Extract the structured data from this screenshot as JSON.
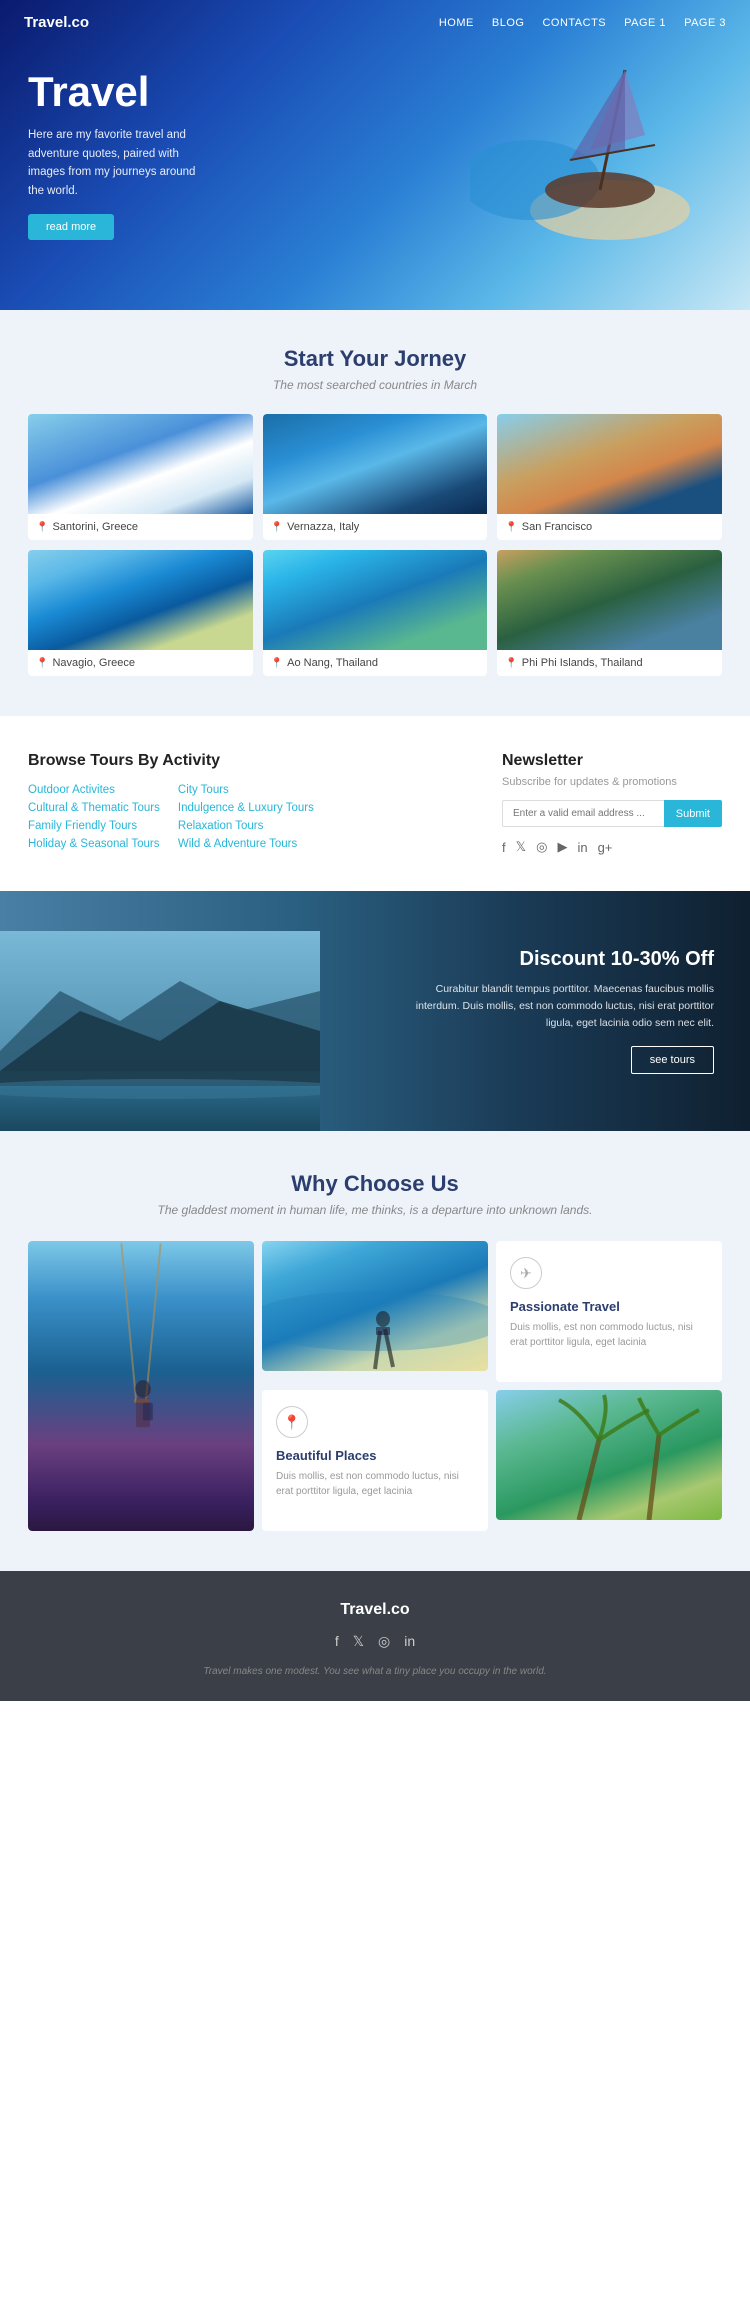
{
  "nav": {
    "logo": "Travel.co",
    "links": [
      "HOME",
      "BLOG",
      "CONTACTS",
      "PAGE 1",
      "PAGE 3"
    ]
  },
  "hero": {
    "title": "Travel",
    "description": "Here are my favorite travel and adventure quotes, paired with images from my journeys around the world.",
    "cta_button": "read more"
  },
  "destinations": {
    "heading": "Start Your Jorney",
    "subtitle": "The most searched countries in March",
    "cards": [
      {
        "name": "Santorini, Greece",
        "color_class": "img-santorini"
      },
      {
        "name": "Vernazza, Italy",
        "color_class": "img-vernazza"
      },
      {
        "name": "San Francisco",
        "color_class": "img-sanfrancisco"
      },
      {
        "name": "Navagio, Greece",
        "color_class": "img-navagio"
      },
      {
        "name": "Ao Nang, Thailand",
        "color_class": "img-aonang"
      },
      {
        "name": "Phi Phi Islands, Thailand",
        "color_class": "img-phiphi"
      }
    ]
  },
  "browse": {
    "heading": "Browse Tours By Activity",
    "col1": [
      "Outdoor Activites",
      "Cultural & Thematic Tours",
      "Family Friendly Tours",
      "Holiday & Seasonal Tours"
    ],
    "col2": [
      "City Tours",
      "Indulgence & Luxury Tours",
      "Relaxation Tours",
      "Wild & Adventure Tours"
    ]
  },
  "newsletter": {
    "heading": "Newsletter",
    "subtitle": "Subscribe for updates & promotions",
    "placeholder": "Enter a valid email address ...",
    "button": "Submit"
  },
  "discount": {
    "heading": "Discount 10-30% Off",
    "body": "Curabitur blandit tempus porttitor. Maecenas faucibus mollis interdum. Duis mollis, est non commodo luctus, nisi erat porttitor ligula, eget lacinia odio sem nec elit.",
    "button": "see tours"
  },
  "why": {
    "heading": "Why Choose Us",
    "subtitle": "The gladdest moment in human life, me thinks, is a departure into unknown lands.",
    "cards": [
      {
        "icon": "✈",
        "title": "Passionate Travel",
        "text": "Duis mollis, est non commodo luctus, nisi erat porttitor ligula, eget lacinia"
      },
      {
        "icon": "📍",
        "title": "Beautiful Places",
        "text": "Duis mollis, est non commodo luctus, nisi erat porttitor ligula, eget lacinia"
      }
    ]
  },
  "footer": {
    "logo": "Travel.co",
    "tagline": "Travel makes one modest. You see what a tiny place you occupy in the world.",
    "social": [
      "f",
      "t",
      "ig",
      "in"
    ]
  }
}
